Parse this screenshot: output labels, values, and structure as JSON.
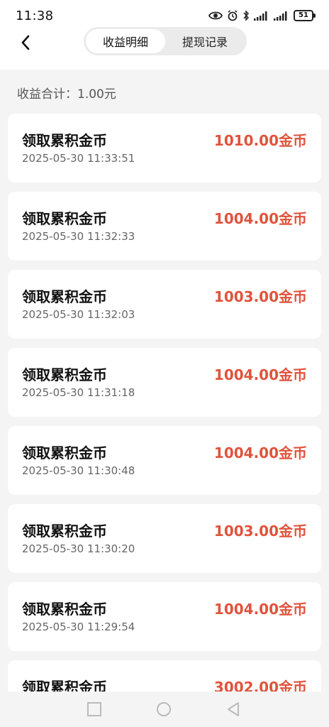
{
  "status": {
    "time": "11:38",
    "battery": "51"
  },
  "header": {
    "tabs": [
      {
        "label": "收益明细",
        "active": true
      },
      {
        "label": "提现记录",
        "active": false
      }
    ]
  },
  "summary": {
    "text": "收益合计：1.00元"
  },
  "records": [
    {
      "title": "领取累积金币",
      "time": "2025-05-30 11:33:51",
      "amount": "1010.00金币"
    },
    {
      "title": "领取累积金币",
      "time": "2025-05-30 11:32:33",
      "amount": "1004.00金币"
    },
    {
      "title": "领取累积金币",
      "time": "2025-05-30 11:32:03",
      "amount": "1003.00金币"
    },
    {
      "title": "领取累积金币",
      "time": "2025-05-30 11:31:18",
      "amount": "1004.00金币"
    },
    {
      "title": "领取累积金币",
      "time": "2025-05-30 11:30:48",
      "amount": "1004.00金币"
    },
    {
      "title": "领取累积金币",
      "time": "2025-05-30 11:30:20",
      "amount": "1003.00金币"
    },
    {
      "title": "领取累积金币",
      "time": "2025-05-30 11:29:54",
      "amount": "1004.00金币"
    },
    {
      "title": "领取累积金币",
      "time": "",
      "amount": "3002.00金币"
    }
  ],
  "colors": {
    "amount": "#e0533d",
    "background": "#f4f4f4",
    "card": "#ffffff"
  },
  "icons": {
    "back": "chevron-left-icon",
    "nav_recent": "square-icon",
    "nav_home": "circle-icon",
    "nav_back": "triangle-back-icon"
  }
}
